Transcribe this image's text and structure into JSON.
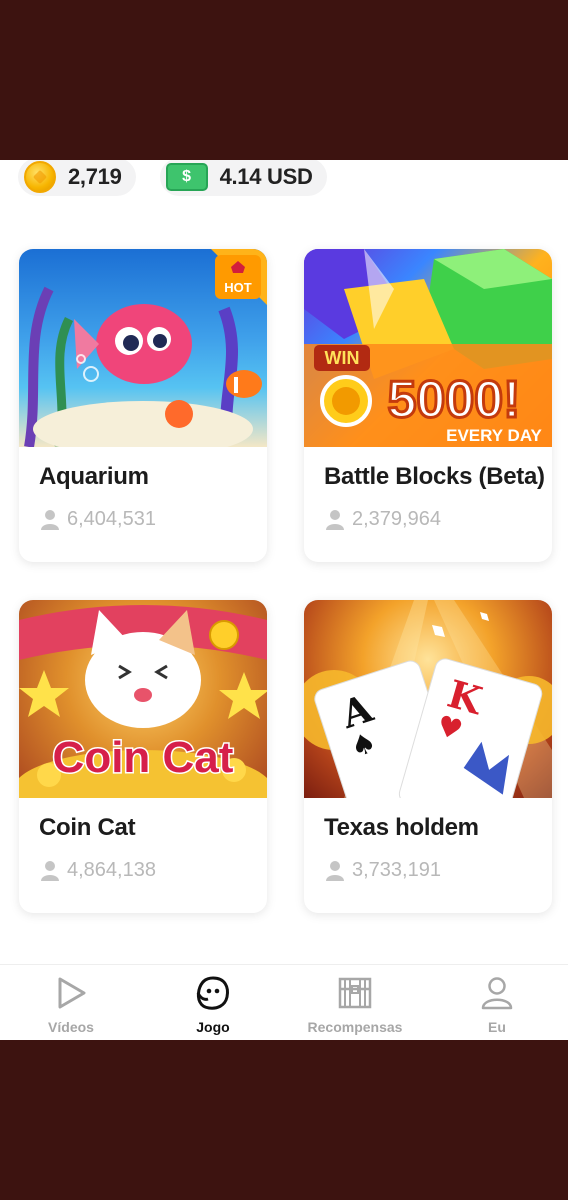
{
  "balances": {
    "coins": "2,719",
    "cash": "4.14 USD",
    "cash_icon_symbol": "$"
  },
  "games": [
    {
      "title": "Aquarium",
      "players": "6,404,531",
      "badge": "HOT"
    },
    {
      "title": "Battle Blocks (Beta)",
      "players": "2,379,964",
      "art_text": {
        "win": "WIN",
        "amount": "5000!",
        "sub": "EVERY DAY"
      }
    },
    {
      "title": "Coin Cat",
      "players": "4,864,138",
      "art_text": {
        "logo": "Coin Cat"
      }
    },
    {
      "title": "Texas holdem",
      "players": "3,733,191",
      "art_text": {
        "card1": "A",
        "card2": "K"
      }
    }
  ],
  "nav": {
    "items": [
      {
        "label": "Vídeos",
        "icon": "play-icon",
        "active": false
      },
      {
        "label": "Jogo",
        "icon": "game-face-icon",
        "active": true
      },
      {
        "label": "Recompensas",
        "icon": "treasure-chest-icon",
        "active": false
      },
      {
        "label": "Eu",
        "icon": "person-icon",
        "active": false
      }
    ]
  },
  "colors": {
    "outer_background": "#3d1310",
    "coin": "#f7b500",
    "cash": "#3ec46d",
    "inactive_nav": "#a7a7a7",
    "active_nav": "#111111"
  }
}
